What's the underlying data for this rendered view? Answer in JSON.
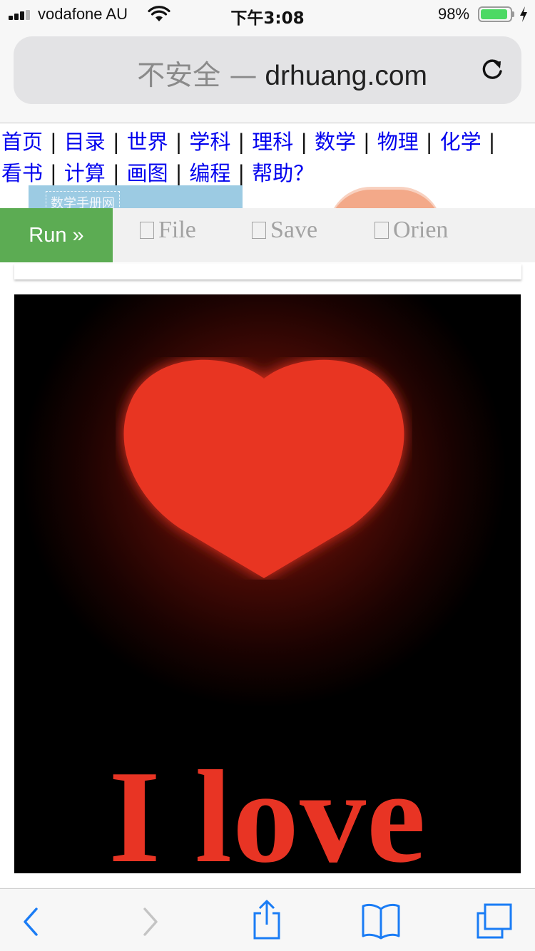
{
  "status_bar": {
    "carrier": "vodafone AU",
    "time": "下午3:08",
    "battery_percent": "98%",
    "battery_level": 0.98,
    "signal_bars_active": 3
  },
  "url_bar": {
    "security_label": "不安全 —",
    "domain": "drhuang.com",
    "reload_icon": "reload-icon"
  },
  "site_nav": {
    "row1": [
      "首页",
      "目录",
      "世界",
      "学科",
      "理科",
      "数学",
      "物理",
      "化学"
    ],
    "row2": [
      "看书",
      "计算",
      "画图",
      "编程",
      "帮助？"
    ],
    "separator": "|"
  },
  "banner": {
    "left_tag": "数学手册网"
  },
  "editor_toolbar": {
    "run_label": "Run »",
    "file_label": "File",
    "save_label": "Save",
    "orien_label": "Orien"
  },
  "canvas": {
    "text": "I love",
    "heart_color": "#e83424",
    "background_color": "#000000"
  },
  "bottom_bar": {
    "back_icon": "back-icon",
    "forward_icon": "forward-icon",
    "share_icon": "share-icon",
    "bookmarks_icon": "bookmarks-icon",
    "tabs_icon": "tabs-icon",
    "accent_color": "#1a7cf5"
  }
}
